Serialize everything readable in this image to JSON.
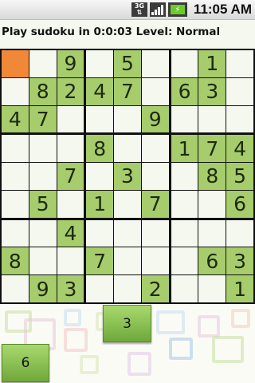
{
  "status_bar": {
    "network_label": "3G",
    "time": "11:05 AM",
    "icons": [
      "3g-data-icon",
      "signal-strength-icon",
      "battery-charging-icon"
    ]
  },
  "game": {
    "title": "Play sudoku in 0:0:03 Level: Normal",
    "selected_cell": [
      0,
      0
    ]
  },
  "board": [
    [
      "",
      "",
      "9",
      "",
      "5",
      "",
      "",
      "1",
      ""
    ],
    [
      "",
      "8",
      "2",
      "4",
      "7",
      "",
      "6",
      "3",
      ""
    ],
    [
      "4",
      "7",
      "",
      "",
      "",
      "9",
      "",
      "",
      ""
    ],
    [
      "",
      "",
      "",
      "8",
      "",
      "",
      "1",
      "7",
      "4"
    ],
    [
      "",
      "",
      "7",
      "",
      "3",
      "",
      "",
      "8",
      "5"
    ],
    [
      "",
      "5",
      "",
      "1",
      "",
      "7",
      "",
      "",
      "6"
    ],
    [
      "",
      "",
      "4",
      "",
      "",
      "",
      "",
      "",
      ""
    ],
    [
      "8",
      "",
      "",
      "7",
      "",
      "",
      "",
      "6",
      "3"
    ],
    [
      "",
      "9",
      "3",
      "",
      "",
      "2",
      "",
      "",
      "1"
    ]
  ],
  "number_buttons": [
    {
      "label": "3"
    },
    {
      "label": "6"
    }
  ],
  "colors": {
    "given_cell": "#a6cc6c",
    "empty_cell": "#f4f8ef",
    "selected_cell": "#f08838",
    "grid_line": "#111111",
    "button_green": "#8cc553"
  }
}
